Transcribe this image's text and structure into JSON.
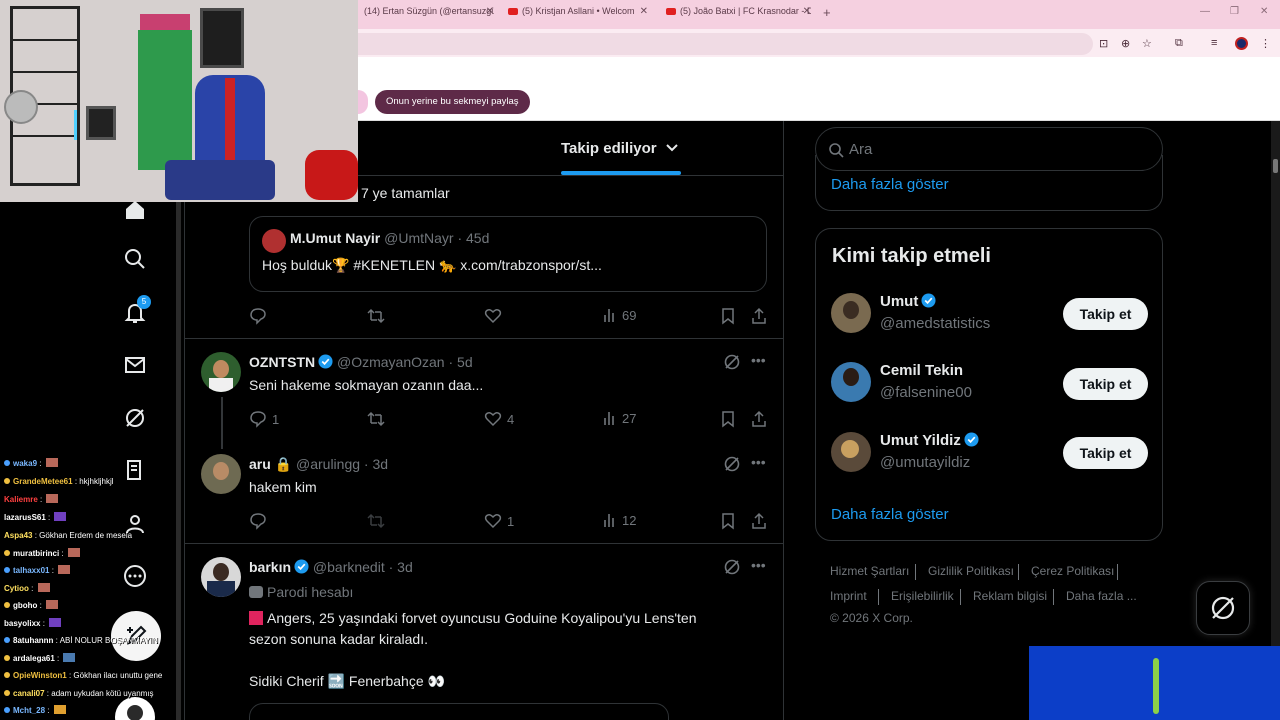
{
  "browser": {
    "tabs": [
      {
        "title": "(14) Ertan Süzgün (@ertansuzgü"
      },
      {
        "title": "(5) Kristjan Asllani • Welcom"
      },
      {
        "title": "(5) João Batxi | FC Krasnodar - D"
      }
    ],
    "share_button_label": "Onun yerine bu sekmeyi paylaş"
  },
  "chat": {
    "lines": [
      {
        "user": "waka9",
        "text": "",
        "color": "#7ab8ff",
        "emote": true
      },
      {
        "user": "GrandeMetee61",
        "text": "hkjhkljhkjl",
        "color": "#f0c040",
        "emote": false
      },
      {
        "user": "Kaliemre",
        "text": "",
        "color": "#ff4040",
        "emote": true
      },
      {
        "user": "lazarusS61",
        "text": "",
        "color": "#ffffff",
        "emote": true
      },
      {
        "user": "Aspa43",
        "text": "Gökhan Erdem de mesela",
        "color": "#ffe060",
        "emote": false
      },
      {
        "user": "muratbirinci",
        "text": "",
        "color": "#ffffff",
        "emote": true
      },
      {
        "user": "talhaxx01",
        "text": "",
        "color": "#7ab8ff",
        "emote": true
      },
      {
        "user": "Cytioo",
        "text": "",
        "color": "#ffe060",
        "emote": true
      },
      {
        "user": "gboho",
        "text": "",
        "color": "#ffffff",
        "emote": true
      },
      {
        "user": "basyolixx",
        "text": "",
        "color": "#ffffff",
        "emote": true
      },
      {
        "user": "8atuhannn",
        "text": "ABİ NOLUR BOŞANMAYIN",
        "color": "#ffffff",
        "emote": false
      },
      {
        "user": "ardalega61",
        "text": "",
        "color": "#ffffff",
        "emote": true
      },
      {
        "user": "OpieWinston1",
        "text": "Gökhan ilacı unuttu gene",
        "color": "#f0c040",
        "emote": false
      },
      {
        "user": "canali07",
        "text": "adam uykudan kötü uyanmış",
        "color": "#ffe060",
        "emote": false
      },
      {
        "user": "Mcht_28",
        "text": "",
        "color": "#7ab8ff",
        "emote": true
      }
    ]
  },
  "nav": {
    "notification_count": "5"
  },
  "timeline": {
    "header_label": "Takip ediliyor",
    "tweet1": {
      "partial_text": "7 ye tamamlar",
      "quote_name": "M.Umut Nayir",
      "quote_handle": "@UmtNayr",
      "quote_time": "· 45d",
      "quote_text": "Hoş bulduk🏆 #KENETLEN 🐆 x.com/trabzonspor/st...",
      "views": "69"
    },
    "tweet2": {
      "name": "OZNTSTN",
      "handle": "@OzmayanOzan",
      "time": "· 5d",
      "text": "Seni hakeme sokmayan ozanın daa...",
      "replies": "1",
      "likes": "4",
      "views": "27"
    },
    "tweet3": {
      "name": "aru 🔒",
      "handle": "@arulingg",
      "time": "· 3d",
      "text": "hakem kim",
      "likes": "1",
      "views": "12"
    },
    "tweet4": {
      "name": "barkın",
      "handle": "@barknedit",
      "time": "· 3d",
      "label": "Parodi hesabı",
      "line1": "Angers, 25 yaşındaki forvet oyuncusu Goduine Koyalipou'yu Lens'ten",
      "line2": "sezon sonuna kadar kiraladı.",
      "line3": "Sidiki Cherif 🔜 Fenerbahçe 👀"
    }
  },
  "sidebar": {
    "search_placeholder": "Ara",
    "show_more_top": "Daha fazla göster",
    "who_to_follow_title": "Kimi takip etmeli",
    "suggestions": [
      {
        "name": "Umut",
        "handle": "@amedstatistics",
        "verified": true,
        "button": "Takip et"
      },
      {
        "name": "Cemil Tekin",
        "handle": "@falsenine00",
        "verified": false,
        "button": "Takip et"
      },
      {
        "name": "Umut Yildiz",
        "handle": "@umutayildiz",
        "verified": true,
        "button": "Takip et"
      }
    ],
    "show_more_bottom": "Daha fazla göster",
    "footer": {
      "terms": "Hizmet Şartları",
      "privacy": "Gizlilik Politikası",
      "cookies": "Çerez Politikası",
      "imprint": "Imprint",
      "accessibility": "Erişilebilirlik",
      "ads": "Reklam bilgisi",
      "more": "Daha fazla ...",
      "copyright": "© 2026 X Corp."
    }
  },
  "colors": {
    "accent": "#1d9bf0",
    "background": "#000000",
    "border": "#2f3336",
    "muted": "#71767b"
  }
}
